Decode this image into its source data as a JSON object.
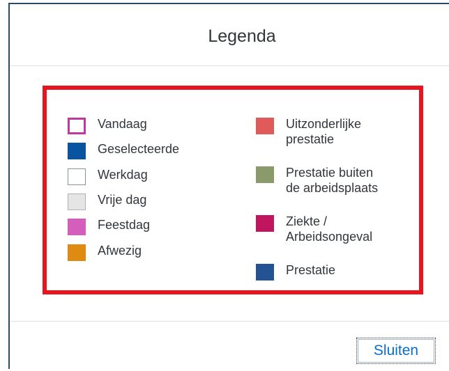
{
  "dialog": {
    "title": "Legenda",
    "close_label": "Sluiten"
  },
  "legend": {
    "left": [
      {
        "label": "Vandaag",
        "color": "#ffffff",
        "border": "#c0399f",
        "icon": "today-swatch"
      },
      {
        "label": "Geselecteerde",
        "color": "#0854a1",
        "border": "#0854a1",
        "icon": "selected-swatch"
      },
      {
        "label": "Werkdag",
        "color": "#ffffff",
        "border": "#89919a",
        "icon": "workday-swatch"
      },
      {
        "label": "Vrije dag",
        "color": "#e5e5e5",
        "border": "#b0b0b0",
        "icon": "day-off-swatch"
      },
      {
        "label": "Feestdag",
        "color": "#d35ebc",
        "border": "#d35ebc",
        "icon": "holiday-swatch"
      },
      {
        "label": "Afwezig",
        "color": "#df8a10",
        "border": "#df8a10",
        "icon": "absent-swatch"
      }
    ],
    "right": [
      {
        "label_lines": [
          "Uitzonderlijke",
          "prestatie"
        ],
        "color": "#e05a5a",
        "border": "#e05a5a",
        "icon": "exceptional-performance-swatch"
      },
      {
        "label_lines": [
          "Prestatie buiten",
          "de arbeidsplaats"
        ],
        "color": "#8b9a6a",
        "border": "#8b9a6a",
        "icon": "offsite-performance-swatch"
      },
      {
        "label_lines": [
          "Ziekte /",
          "Arbeidsongeval"
        ],
        "color": "#c0155f",
        "border": "#c0155f",
        "icon": "illness-accident-swatch"
      },
      {
        "label_lines": [
          "Prestatie"
        ],
        "color": "#245394",
        "border": "#245394",
        "icon": "performance-swatch"
      }
    ]
  }
}
